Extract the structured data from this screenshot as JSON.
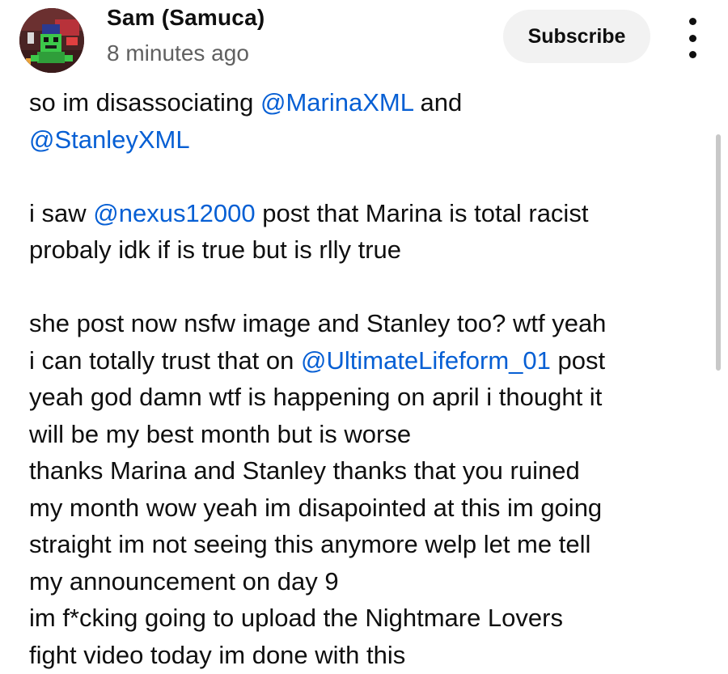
{
  "post": {
    "channel_name": "Sam (Samuca)",
    "timestamp": "8 minutes ago",
    "subscribe_label": "Subscribe",
    "more_icon": "more-vert-icon",
    "lines": [
      [
        {
          "t": "so im disassociating "
        },
        {
          "t": "@MarinaXML",
          "m": true
        },
        {
          "t": " and"
        }
      ],
      [
        {
          "t": "@StanleyXML",
          "m": true
        }
      ],
      [],
      [
        {
          "t": "i saw "
        },
        {
          "t": "@nexus12000",
          "m": true
        },
        {
          "t": " post that Marina is total racist"
        }
      ],
      [
        {
          "t": "probaly idk if is true but is rlly true"
        }
      ],
      [],
      [
        {
          "t": "she post now nsfw image and Stanley too? wtf yeah"
        }
      ],
      [
        {
          "t": "i can totally trust that on "
        },
        {
          "t": "@UltimateLifeform_01",
          "m": true
        },
        {
          "t": " post"
        }
      ],
      [
        {
          "t": "yeah god damn wtf is happening on april i thought it"
        }
      ],
      [
        {
          "t": "will be my best month but is worse"
        }
      ],
      [
        {
          "t": "thanks Marina and Stanley thanks that you ruined"
        }
      ],
      [
        {
          "t": "my month wow yeah im disapointed at this im going"
        }
      ],
      [
        {
          "t": "straight im not seeing this anymore welp let me tell"
        }
      ],
      [
        {
          "t": "my announcement on day 9"
        }
      ],
      [
        {
          "t": "im f*cking going to upload the Nightmare Lovers"
        }
      ],
      [
        {
          "t": "fight video today im done with this"
        }
      ]
    ]
  },
  "colors": {
    "mention": "#065fd4",
    "text": "#0f0f0f",
    "secondary_text": "#606060",
    "subscribe_bg": "#f2f2f2"
  }
}
